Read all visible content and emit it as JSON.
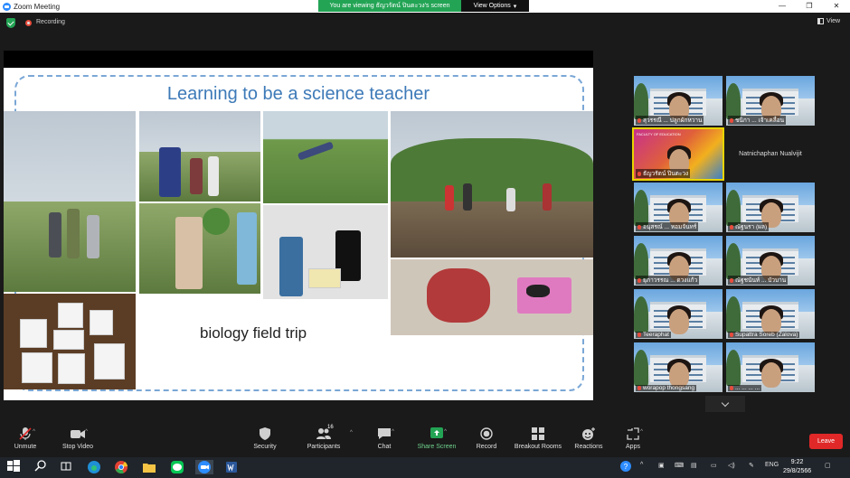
{
  "window": {
    "title": "Zoom Meeting",
    "viewing_banner": "You are viewing ธัญวรัตน์ ปินตะวง's screen",
    "view_options": "View Options",
    "recording": "Recording",
    "view_button": "View"
  },
  "slide": {
    "title": "Learning to be a science teacher",
    "caption": "biology field trip"
  },
  "gallery": [
    {
      "name": "สุวรรณี ... ปลูกผักหวาน"
    },
    {
      "name": "ชนิกา ... เจ้าเคลื่อน"
    },
    {
      "name": "ธัญวรัตน์ ปินตะวง",
      "active": true,
      "banner": "FACULTY OF EDUCATION"
    },
    {
      "name": "Natnichaphan Nualvijit",
      "no_video": true
    },
    {
      "name": "อนุสรณ์ ... หอมจันทร์"
    },
    {
      "name": "ณัฐนรา (ผล)"
    },
    {
      "name": "ยุภาวรรณ ... ดวงแก้ว"
    },
    {
      "name": "ณัฐชนันท์ ... บัวบาน"
    },
    {
      "name": "Teeraphat"
    },
    {
      "name": "Supattra Soreb (Zalova)"
    },
    {
      "name": "worapop thongsang"
    },
    {
      "name": "... ... ... ..."
    }
  ],
  "toolbar": {
    "unmute": "Unmute",
    "stop_video": "Stop Video",
    "security": "Security",
    "participants": "Participants",
    "participants_count": "16",
    "chat": "Chat",
    "share_screen": "Share Screen",
    "record": "Record",
    "breakout_rooms": "Breakout Rooms",
    "reactions": "Reactions",
    "apps": "Apps",
    "leave": "Leave"
  },
  "taskbar": {
    "lang": "ENG",
    "time": "9:22",
    "date": "29/8/2566"
  },
  "colors": {
    "accent_green": "#23a455",
    "leave_red": "#e02828",
    "active_speaker": "#e8d400",
    "slide_title_blue": "#3d7ab8"
  }
}
